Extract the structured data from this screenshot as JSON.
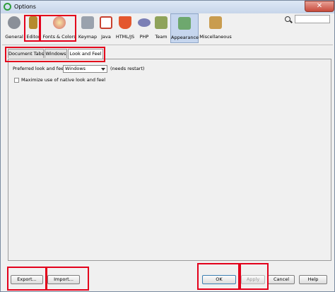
{
  "window": {
    "title": "Options",
    "close_glyph": "✕"
  },
  "toolbar": {
    "items": [
      {
        "label": "General",
        "icon": "gears-icon",
        "color": "#8a8f98"
      },
      {
        "label": "Editor",
        "icon": "editor-pencil-icon",
        "color": "#b58a2e"
      },
      {
        "label": "Fonts & Colors",
        "icon": "fonts-colors-icon",
        "color": "#d66a6a"
      },
      {
        "label": "Keymap",
        "icon": "keyboard-icon",
        "color": "#9aa2ad"
      },
      {
        "label": "Java",
        "icon": "java-cup-icon",
        "color": "#c8402e"
      },
      {
        "label": "HTML/JS",
        "icon": "html5-icon",
        "color": "#e4572e"
      },
      {
        "label": "PHP",
        "icon": "php-icon",
        "color": "#7b7fb5"
      },
      {
        "label": "Team",
        "icon": "team-icon",
        "color": "#8fa35a"
      },
      {
        "label": "Appearance",
        "icon": "appearance-icon",
        "color": "#6ea86e"
      },
      {
        "label": "Miscellaneous",
        "icon": "misc-icon",
        "color": "#c99c4f"
      }
    ],
    "search_placeholder": ""
  },
  "tabs": [
    {
      "label": "Document Tabs",
      "active": false
    },
    {
      "label": "Windows",
      "active": false
    },
    {
      "label": "Look and Feel",
      "active": true
    }
  ],
  "panel": {
    "preferred_label": "Preferred look and feel:",
    "preferred_value": "Windows",
    "restart_note": "(needs restart)",
    "maximize_label": "Maximize use of native look and feel",
    "maximize_checked": false
  },
  "buttons": {
    "export": "Export...",
    "import": "Import...",
    "ok": "OK",
    "apply": "Apply",
    "cancel": "Cancel",
    "help": "Help"
  },
  "colors": {
    "highlight": "#e3001b",
    "selected_tab": "#c6d6ee"
  }
}
